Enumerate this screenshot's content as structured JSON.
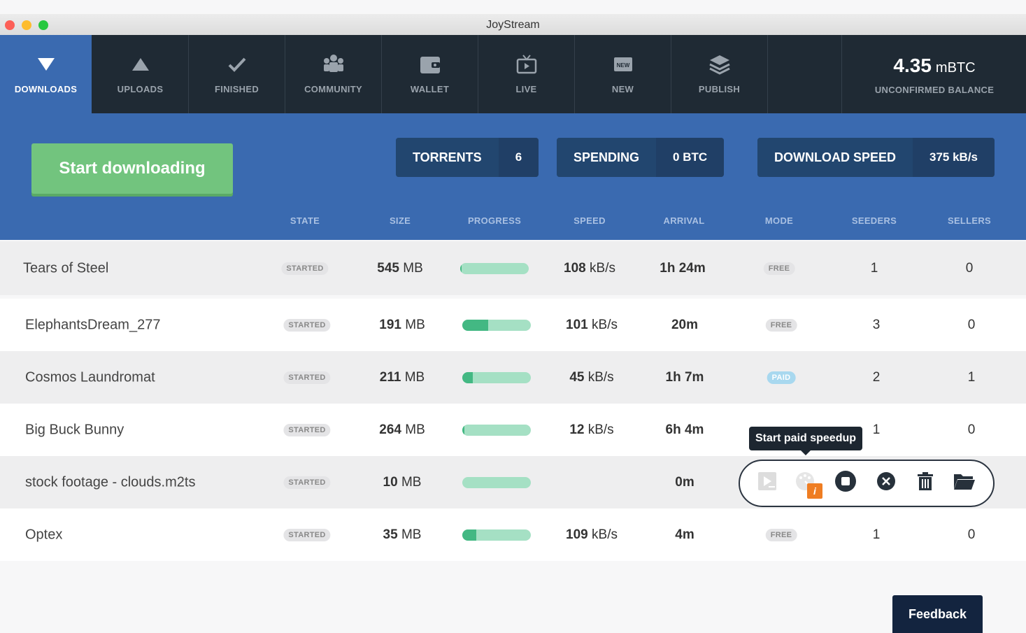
{
  "window": {
    "title": "JoyStream"
  },
  "nav": {
    "tabs": [
      {
        "label": "DOWNLOADS",
        "icon": "triangle-down-icon"
      },
      {
        "label": "UPLOADS",
        "icon": "triangle-up-icon"
      },
      {
        "label": "FINISHED",
        "icon": "checkmark-icon"
      },
      {
        "label": "COMMUNITY",
        "icon": "community-icon"
      },
      {
        "label": "WALLET",
        "icon": "wallet-icon"
      },
      {
        "label": "LIVE",
        "icon": "tv-icon"
      },
      {
        "label": "NEW",
        "icon": "new-icon"
      },
      {
        "label": "PUBLISH",
        "icon": "layers-icon"
      }
    ],
    "active_tab": "DOWNLOADS",
    "balance": {
      "value": "4.35",
      "unit": "mBTC",
      "label": "UNCONFIRMED BALANCE"
    }
  },
  "panel": {
    "start_label": "Start downloading",
    "stats": [
      {
        "label": "TORRENTS",
        "value": "6"
      },
      {
        "label": "SPENDING",
        "value": "0 BTC"
      },
      {
        "label": "DOWNLOAD SPEED",
        "value": "375 kB/s"
      }
    ]
  },
  "table": {
    "columns": [
      "STATE",
      "SIZE",
      "PROGRESS",
      "SPEED",
      "ARRIVAL",
      "MODE",
      "SEEDERS",
      "SELLERS"
    ],
    "rows": [
      {
        "name": "Tears of Steel",
        "state": "STARTED",
        "size_num": "545",
        "size_unit": "MB",
        "progress": 0.02,
        "speed_num": "108",
        "speed_unit": "kB/s",
        "arrival": "1h 24m",
        "mode": "FREE",
        "seeders": "1",
        "sellers": "0"
      },
      {
        "name": "ElephantsDream_277",
        "state": "STARTED",
        "size_num": "191",
        "size_unit": "MB",
        "progress": 0.38,
        "speed_num": "101",
        "speed_unit": "kB/s",
        "arrival": "20m",
        "mode": "FREE",
        "seeders": "3",
        "sellers": "0"
      },
      {
        "name": "Cosmos Laundromat",
        "state": "STARTED",
        "size_num": "211",
        "size_unit": "MB",
        "progress": 0.15,
        "speed_num": "45",
        "speed_unit": "kB/s",
        "arrival": "1h 7m",
        "mode": "PAID",
        "seeders": "2",
        "sellers": "1"
      },
      {
        "name": "Big Buck Bunny",
        "state": "STARTED",
        "size_num": "264",
        "size_unit": "MB",
        "progress": 0.03,
        "speed_num": "12",
        "speed_unit": "kB/s",
        "arrival": "6h 4m",
        "mode": "",
        "seeders": "1",
        "sellers": "0"
      },
      {
        "name": "stock footage - clouds.m2ts",
        "state": "STARTED",
        "size_num": "10",
        "size_unit": "MB",
        "progress": 0.0,
        "speed_num": "",
        "speed_unit": "",
        "arrival": "0m",
        "mode": "",
        "seeders": "",
        "sellers": ""
      },
      {
        "name": "Optex",
        "state": "STARTED",
        "size_num": "35",
        "size_unit": "MB",
        "progress": 0.2,
        "speed_num": "109",
        "speed_unit": "kB/s",
        "arrival": "4m",
        "mode": "FREE",
        "seeders": "1",
        "sellers": "0"
      }
    ]
  },
  "actions": {
    "tooltip": "Start paid speedup",
    "buttons": [
      "stream-icon",
      "paid-speedup-icon",
      "stop-icon",
      "cancel-icon",
      "trash-icon",
      "folder-icon"
    ],
    "badge": "i"
  },
  "feedback_label": "Feedback",
  "colors": {
    "nav_bg": "#1f2a34",
    "accent_blue": "#3a6ab0",
    "start_green": "#72c47e",
    "progress_fill": "#43b883",
    "progress_track": "#a5e0c4"
  }
}
